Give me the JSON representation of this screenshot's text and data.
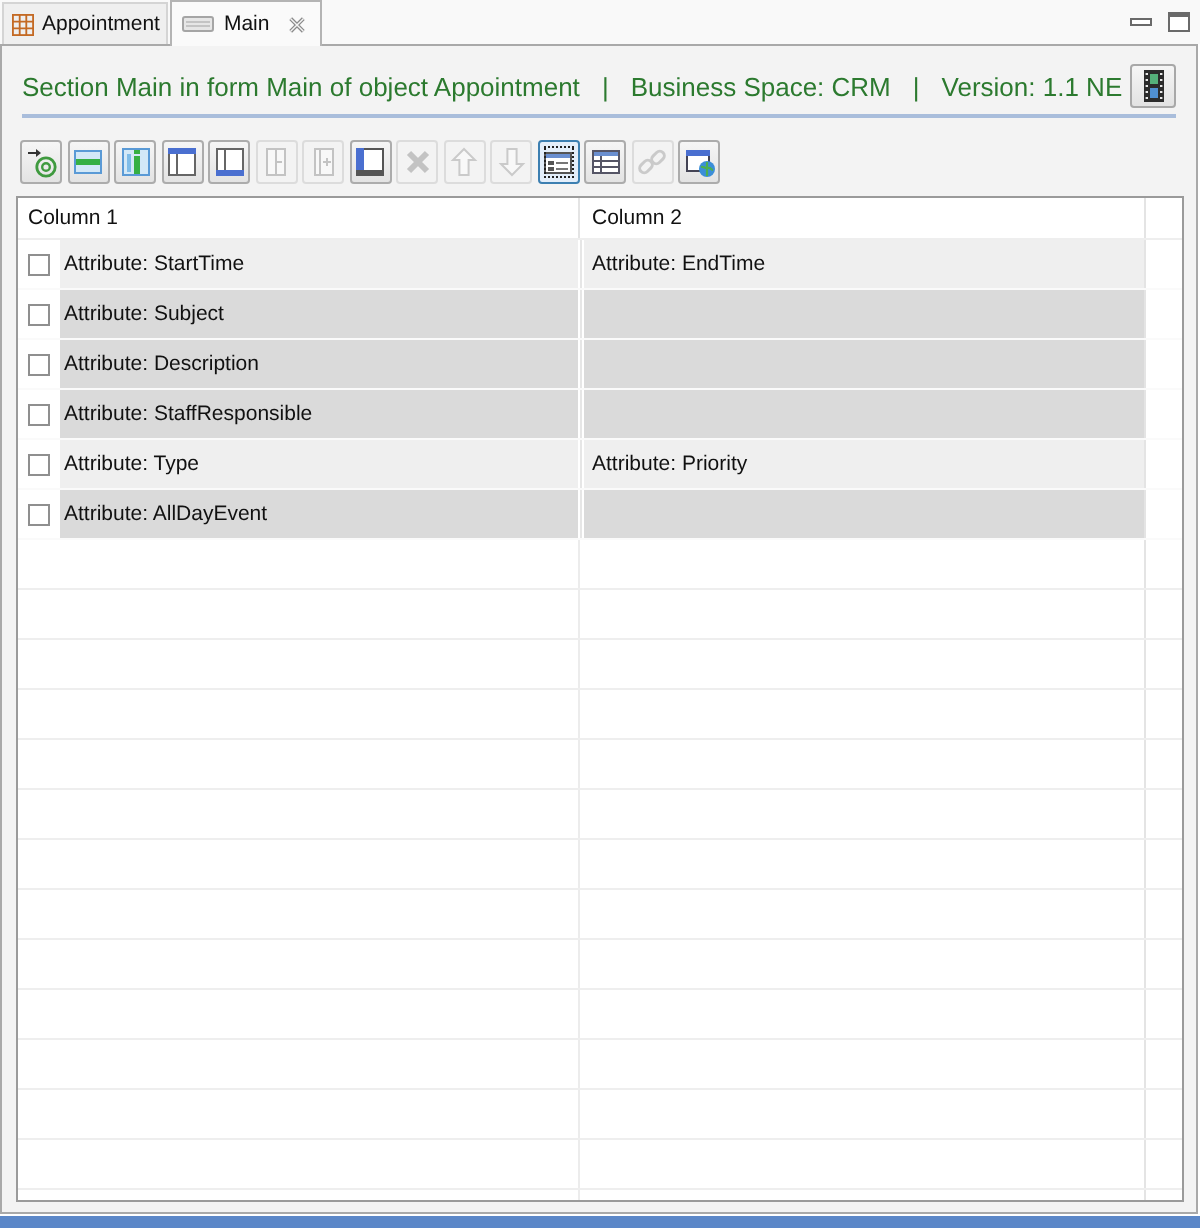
{
  "tabs": [
    {
      "label": "Appointment",
      "selected": false
    },
    {
      "label": "Main",
      "selected": true
    }
  ],
  "header": {
    "segments": [
      "Section Main in form Main of object Appointment",
      "Business Space: CRM",
      "Version: 1.1 NE"
    ],
    "separator": "|"
  },
  "toolbar": [
    {
      "disabled": false,
      "selected": false
    },
    {
      "disabled": false,
      "selected": false
    },
    {
      "disabled": false,
      "selected": false
    },
    {
      "disabled": false,
      "selected": false
    },
    {
      "disabled": false,
      "selected": false
    },
    {
      "disabled": true,
      "selected": false
    },
    {
      "disabled": true,
      "selected": false
    },
    {
      "disabled": false,
      "selected": false
    },
    {
      "disabled": true,
      "selected": false
    },
    {
      "disabled": true,
      "selected": false
    },
    {
      "disabled": true,
      "selected": false
    },
    {
      "disabled": false,
      "selected": true
    },
    {
      "disabled": false,
      "selected": false
    },
    {
      "disabled": true,
      "selected": false
    },
    {
      "disabled": false,
      "selected": false
    }
  ],
  "table": {
    "columns": [
      "Column 1",
      "Column 2"
    ],
    "rows": [
      {
        "checked": false,
        "color": "#efefef",
        "column_1": "Attribute: StartTime",
        "column_2": "Attribute: EndTime"
      },
      {
        "checked": false,
        "color": "#dadada",
        "column_1": "Attribute: Subject"
      },
      {
        "checked": false,
        "color": "#dadada",
        "column_1": "Attribute: Description"
      },
      {
        "checked": false,
        "color": "#dadada",
        "column_1": "Attribute: StaffResponsible"
      },
      {
        "checked": false,
        "color": "#efefef",
        "column_1": "Attribute: Type",
        "column_2": "Attribute: Priority"
      },
      {
        "checked": false,
        "color": "#dadada",
        "column_1": "Attribute: AllDayEvent"
      }
    ]
  }
}
